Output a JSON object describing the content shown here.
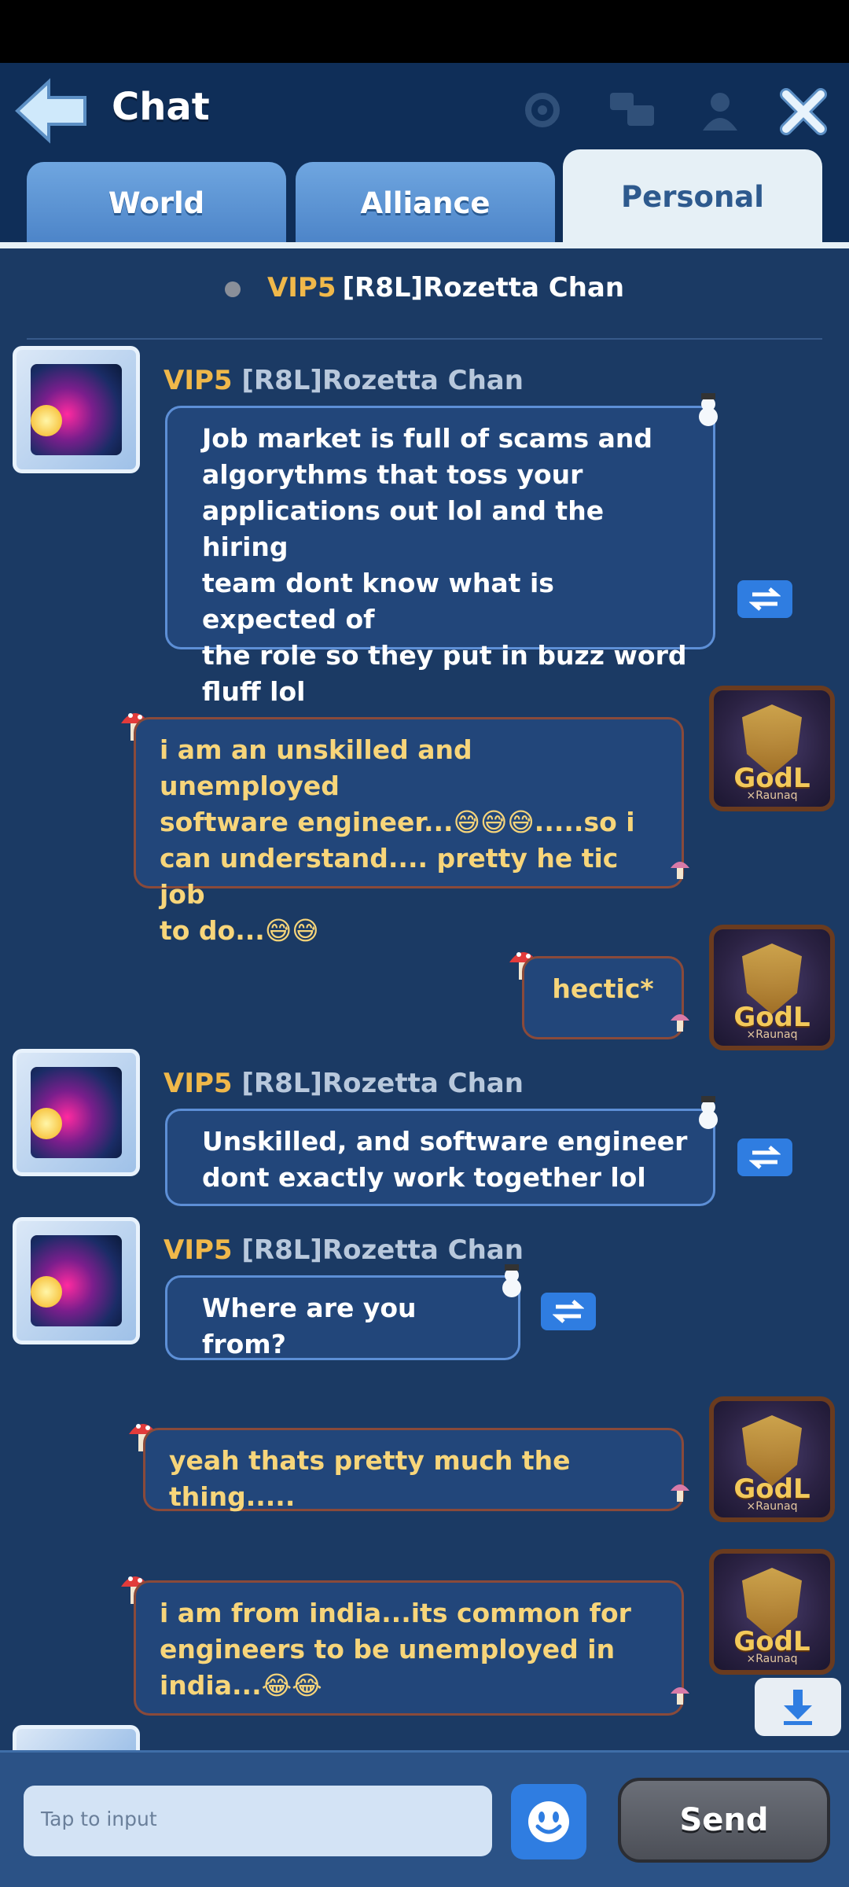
{
  "header": {
    "title": "Chat",
    "tabs": [
      {
        "label": "World"
      },
      {
        "label": "Alliance"
      },
      {
        "label": "Personal"
      }
    ]
  },
  "conversation": {
    "vip": "VIP5",
    "name": "[R8L]Rozetta Chan"
  },
  "messages": [
    {
      "side": "left",
      "vip": "VIP5",
      "sender": "[R8L]Rozetta Chan",
      "lines": [
        "Job market is full of scams and",
        "algorythms that toss your",
        "applications out lol and the hiring",
        "team dont know what is expected of",
        "the role so they put in buzz word",
        "fluff lol"
      ]
    },
    {
      "side": "right",
      "lines": [
        "i am an unskilled and unemployed",
        "software engineer...😅😅😅.....so i",
        "can understand.... pretty he tic job",
        "to do...😅😅"
      ]
    },
    {
      "side": "right",
      "lines": [
        "hectic*"
      ]
    },
    {
      "side": "left",
      "vip": "VIP5",
      "sender": "[R8L]Rozetta Chan",
      "lines": [
        "Unskilled, and software engineer",
        "dont exactly work together lol"
      ]
    },
    {
      "side": "left",
      "vip": "VIP5",
      "sender": "[R8L]Rozetta Chan",
      "lines": [
        "Where are you from?"
      ]
    },
    {
      "side": "right",
      "lines": [
        "yeah thats pretty much the thing....."
      ]
    },
    {
      "side": "right",
      "lines": [
        "i am from india...its common for",
        "engineers to be unemployed in",
        "india...😂😂"
      ]
    }
  ],
  "avatar_right": {
    "title": "GodL",
    "subtitle": "×Raunaq"
  },
  "footer": {
    "input_placeholder": "Tap to input",
    "send_label": "Send"
  },
  "icons": [
    "back-arrow-icon",
    "settings-icon",
    "group-icon",
    "person-icon",
    "close-icon",
    "translate-icon",
    "scroll-down-icon",
    "emoji-icon"
  ],
  "colors": {
    "vip": "#f0b84a",
    "right_text": "#f7d57a",
    "accent": "#2f7de1"
  }
}
